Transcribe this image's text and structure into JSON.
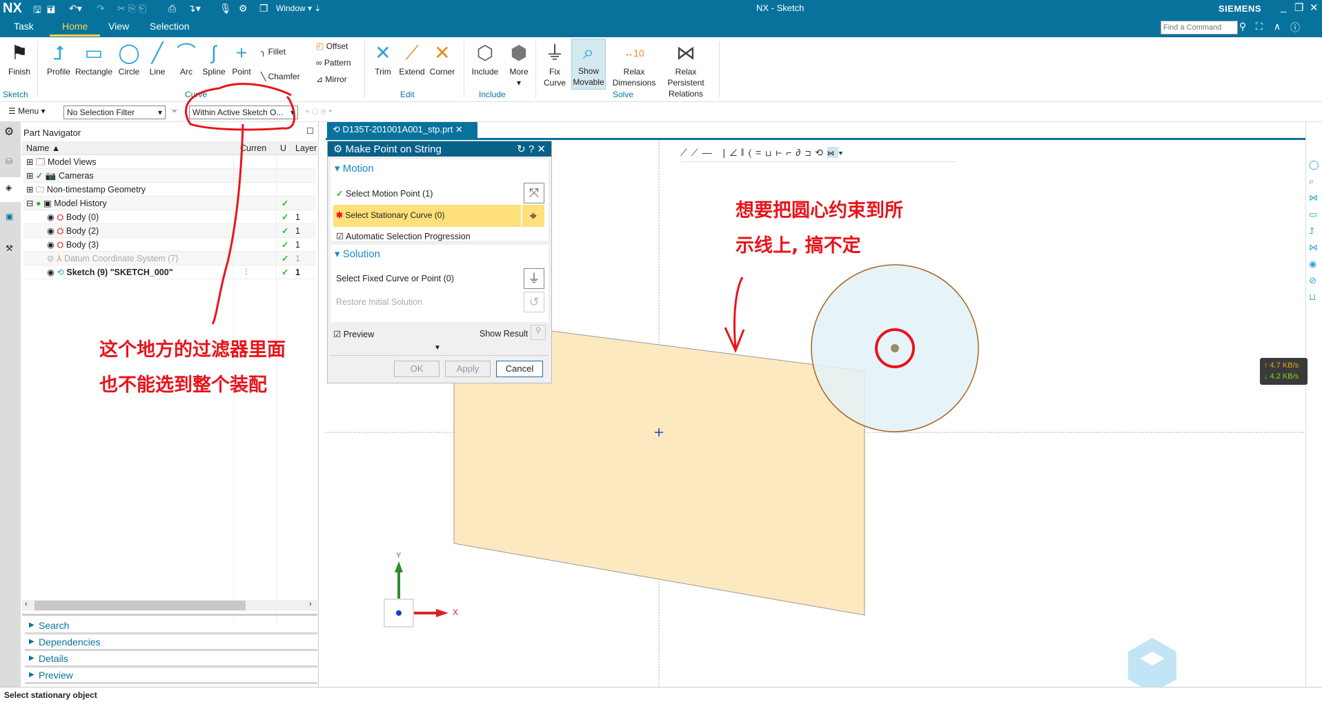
{
  "titlebar": {
    "logo": "NX",
    "title": "NX - Sketch",
    "brand": "SIEMENS",
    "window_menu": "Window",
    "find_placeholder": "Find a Command"
  },
  "tabs": [
    {
      "label": "Task"
    },
    {
      "label": "Home",
      "active": true
    },
    {
      "label": "View"
    },
    {
      "label": "Selection"
    }
  ],
  "ribbon": {
    "buttons": [
      {
        "label": "Finish",
        "icon": "checkered-flag-icon"
      },
      {
        "label": "Profile",
        "icon": "profile-icon"
      },
      {
        "label": "Rectangle",
        "icon": "rectangle-icon"
      },
      {
        "label": "Circle",
        "icon": "circle-icon"
      },
      {
        "label": "Line",
        "icon": "line-icon"
      },
      {
        "label": "Arc",
        "icon": "arc-icon"
      },
      {
        "label": "Spline",
        "icon": "spline-icon"
      },
      {
        "label": "Point",
        "icon": "point-icon"
      },
      {
        "label": "Trim",
        "icon": "trim-icon"
      },
      {
        "label": "Extend",
        "icon": "extend-icon"
      },
      {
        "label": "Corner",
        "icon": "corner-icon"
      },
      {
        "label": "Include",
        "icon": "include-icon"
      },
      {
        "label": "More",
        "icon": "more-icon"
      },
      {
        "label": "Fix Curve",
        "icon": "fix-curve-icon"
      },
      {
        "label": "Show Movable",
        "icon": "show-movable-icon",
        "active": true
      },
      {
        "label": "Relax Dimensions",
        "icon": "relax-dimensions-icon"
      },
      {
        "label": "Relax Persistent Relations",
        "icon": "relax-relations-icon"
      }
    ],
    "small": [
      "Fillet",
      "Chamfer",
      "Offset",
      "Pattern",
      "Mirror"
    ],
    "dimension_icon_value": "10",
    "groups": [
      "Sketch",
      "Curve",
      "Edit",
      "Include",
      "Solve"
    ]
  },
  "selbar": {
    "menu": "Menu",
    "filter": "No Selection Filter",
    "scope": "Within Active Sketch O..."
  },
  "navigator": {
    "title": "Part Navigator",
    "columns": [
      "Name",
      "Curren",
      "U",
      "Layer"
    ],
    "rows": [
      {
        "name": "Model Views",
        "expander": "+",
        "check": false,
        "layer": ""
      },
      {
        "name": "Cameras",
        "expander": "+",
        "check": false,
        "layer": ""
      },
      {
        "name": "Non-timestamp Geometry",
        "expander": "+",
        "check": false,
        "layer": ""
      },
      {
        "name": "Model History",
        "expander": "-",
        "check": true,
        "layer": ""
      },
      {
        "name": "Body (0)",
        "check": true,
        "layer": "1"
      },
      {
        "name": "Body (2)",
        "check": true,
        "layer": "1"
      },
      {
        "name": "Body (3)",
        "check": true,
        "layer": "1"
      },
      {
        "name": "Datum Coordinate System (7)",
        "check": true,
        "layer": "1",
        "dimmed": true
      },
      {
        "name": "Sketch (9) \"SKETCH_000\"",
        "check": true,
        "layer": "1",
        "bold": true
      }
    ],
    "sections": [
      "Search",
      "Dependencies",
      "Details",
      "Preview"
    ]
  },
  "document_tab": "D135T-201001A001_stp.prt",
  "dialog": {
    "title": "Make Point on String",
    "motion": "Motion",
    "select_motion_point": "Select Motion Point (1)",
    "select_stationary_curve": "Select Stationary Curve (0)",
    "auto_progression": "Automatic Selection Progression",
    "solution": "Solution",
    "select_fixed": "Select Fixed Curve or Point (0)",
    "restore": "Restore Initial Solution",
    "preview": "Preview",
    "show_result": "Show Result",
    "ok": "OK",
    "apply": "Apply",
    "cancel": "Cancel"
  },
  "annotations": {
    "left_line1": "这个地方的过滤器里面",
    "left_line2": "也不能选到整个装配",
    "right_line1": "想要把圆心约束到所",
    "right_line2": "示线上, 搞不定"
  },
  "triad": {
    "x": "X",
    "y": "Y"
  },
  "network": {
    "up": "↑ 4.7 KB/s",
    "down": "↓ 4.2 KB/s"
  },
  "status": "Select stationary object",
  "colors": {
    "brand": "#07739d",
    "highlight": "#ffe07a",
    "annotation": "#e8141b",
    "sheet": "#fde9c0",
    "disc": "#e2f2f8"
  }
}
